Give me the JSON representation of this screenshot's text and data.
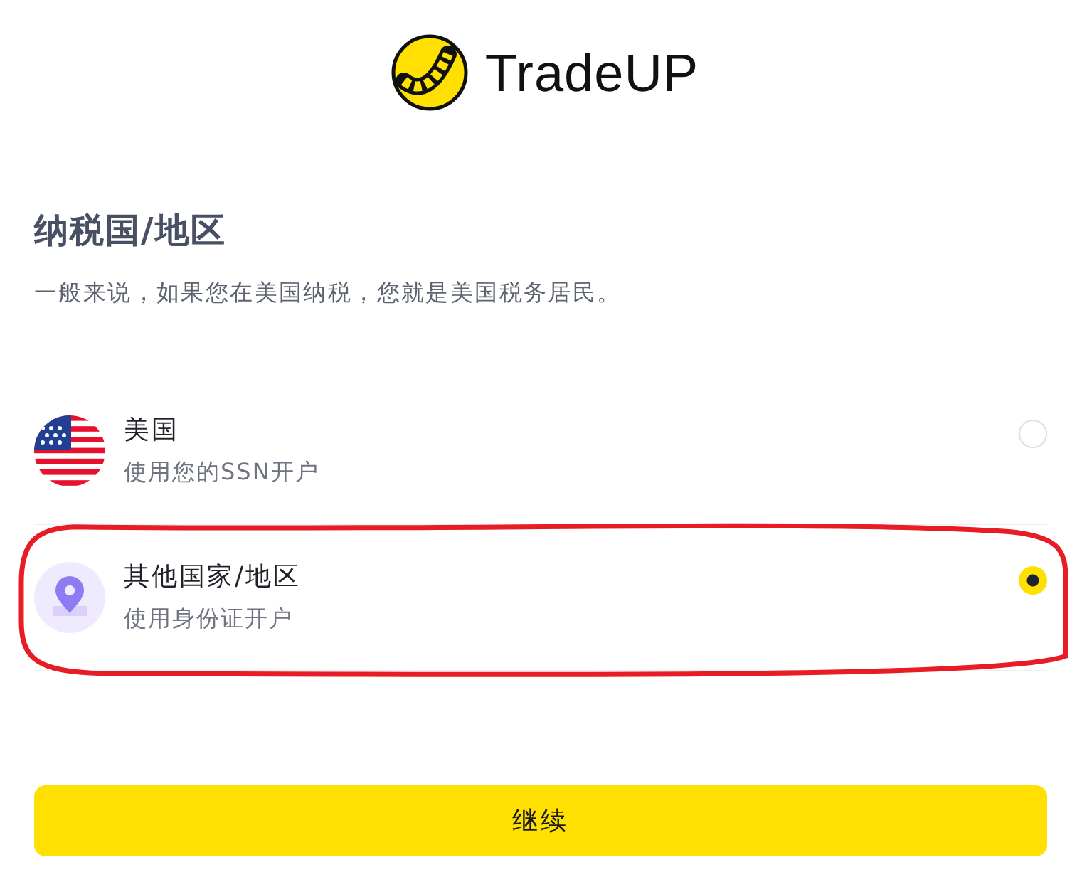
{
  "logo": {
    "text": "TradeUP"
  },
  "heading": {
    "title": "纳税国/地区",
    "description": "一般来说，如果您在美国纳税，您就是美国税务居民。"
  },
  "options": [
    {
      "kind": "flag",
      "title": "美国",
      "subtitle": "使用您的SSN开户",
      "selected": false,
      "annotated": false
    },
    {
      "kind": "location",
      "title": "其他国家/地区",
      "subtitle": "使用身份证开户",
      "selected": true,
      "annotated": true
    }
  ],
  "continue_button": {
    "label": "继续"
  }
}
